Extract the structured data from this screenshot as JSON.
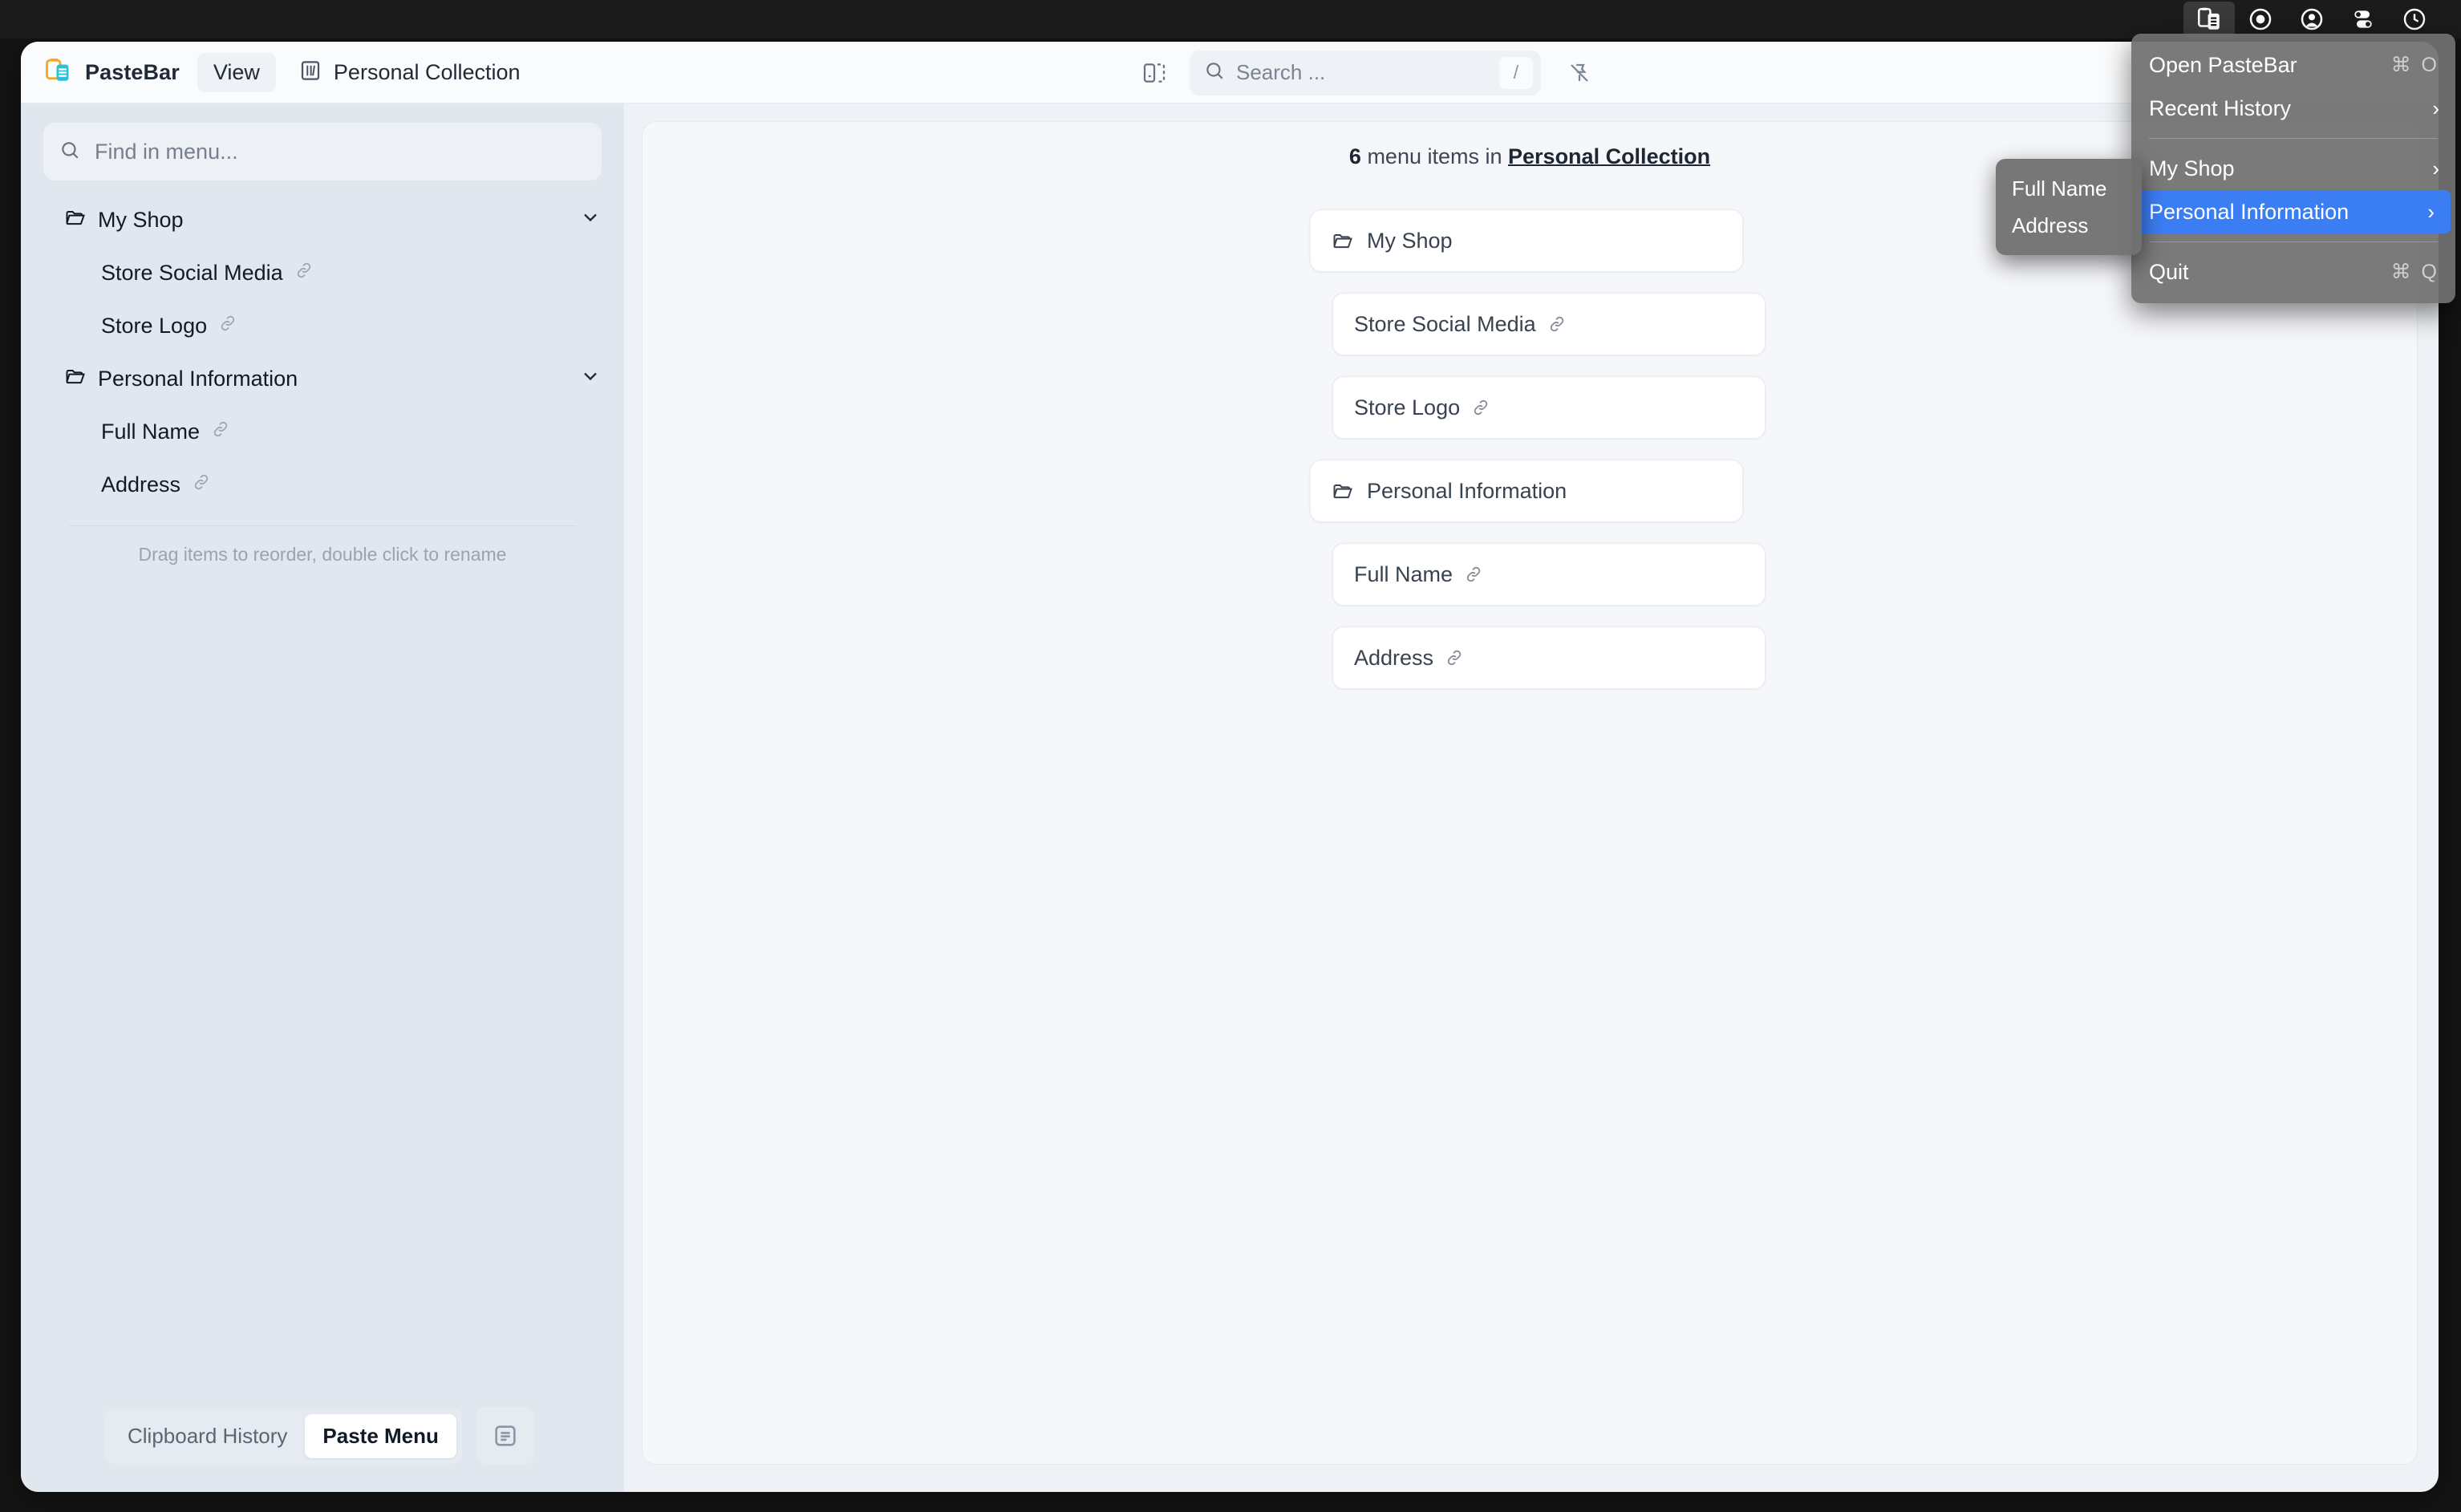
{
  "menubar": {
    "icons": [
      {
        "name": "clipboard-icon",
        "label": "PasteBar",
        "active": true
      },
      {
        "name": "record-circle-icon",
        "label": "Record",
        "active": false
      },
      {
        "name": "user-account-icon",
        "label": "Account",
        "active": false
      },
      {
        "name": "control-toggles-icon",
        "label": "Control Center",
        "active": false
      },
      {
        "name": "clock-icon",
        "label": "Clock",
        "active": false
      }
    ]
  },
  "tray_menu": {
    "items": [
      {
        "label": "Open PasteBar",
        "shortcut": "⌘ O",
        "arrow": false,
        "selected": false
      },
      {
        "label": "Recent History",
        "shortcut": "",
        "arrow": true,
        "selected": false
      },
      {
        "separator": true
      },
      {
        "label": "My Shop",
        "shortcut": "",
        "arrow": true,
        "selected": false
      },
      {
        "label": "Personal Information",
        "shortcut": "",
        "arrow": true,
        "selected": true
      },
      {
        "separator": true
      },
      {
        "label": "Quit",
        "shortcut": "⌘ Q",
        "arrow": false,
        "selected": false
      }
    ]
  },
  "submenu": {
    "items": [
      {
        "label": "Full Name"
      },
      {
        "label": "Address"
      }
    ]
  },
  "header": {
    "app_name": "PasteBar",
    "view_label": "View",
    "collection_name": "Personal Collection",
    "logo_icon": "pastebar-clipboard-logo",
    "collection_icon": "library-books-icon"
  },
  "search": {
    "placeholder": "Search ...",
    "shortcut_key": "/",
    "search_icon": "search-icon",
    "split_view_icon": "split-panel-icon",
    "pin_icon": "pin-off-icon"
  },
  "sidebar": {
    "find_placeholder": "Find in menu...",
    "find_icon": "search-icon",
    "tree": [
      {
        "label": "My Shop",
        "type": "folder",
        "expanded": true
      },
      {
        "label": "Store Social Media",
        "type": "item",
        "linked": true
      },
      {
        "label": "Store Logo",
        "type": "item",
        "linked": true
      },
      {
        "label": "Personal Information",
        "type": "folder",
        "expanded": true
      },
      {
        "label": "Full Name",
        "type": "item",
        "linked": true
      },
      {
        "label": "Address",
        "type": "item",
        "linked": true
      }
    ],
    "hint": "Drag items to reorder, double click to rename",
    "tabs": {
      "clipboard_history": "Clipboard History",
      "paste_menu": "Paste Menu",
      "active": "Paste Menu"
    },
    "notes_icon": "notes-list-icon"
  },
  "main": {
    "count": "6",
    "count_text_middle": " menu items in ",
    "collection_name": "Personal Collection",
    "cards": [
      {
        "label": "My Shop",
        "type": "folder"
      },
      {
        "label": "Store Social Media",
        "type": "item"
      },
      {
        "label": "Store Logo",
        "type": "item"
      },
      {
        "label": "Personal Information",
        "type": "folder"
      },
      {
        "label": "Full Name",
        "type": "item"
      },
      {
        "label": "Address",
        "type": "item"
      }
    ]
  },
  "colors": {
    "accent_blue": "#3b7ef4",
    "logo_orange": "#f5a623",
    "logo_cyan": "#2fc0d8",
    "sidebar_bg": "#e1e7ee",
    "main_bg": "#f5f7fa"
  }
}
